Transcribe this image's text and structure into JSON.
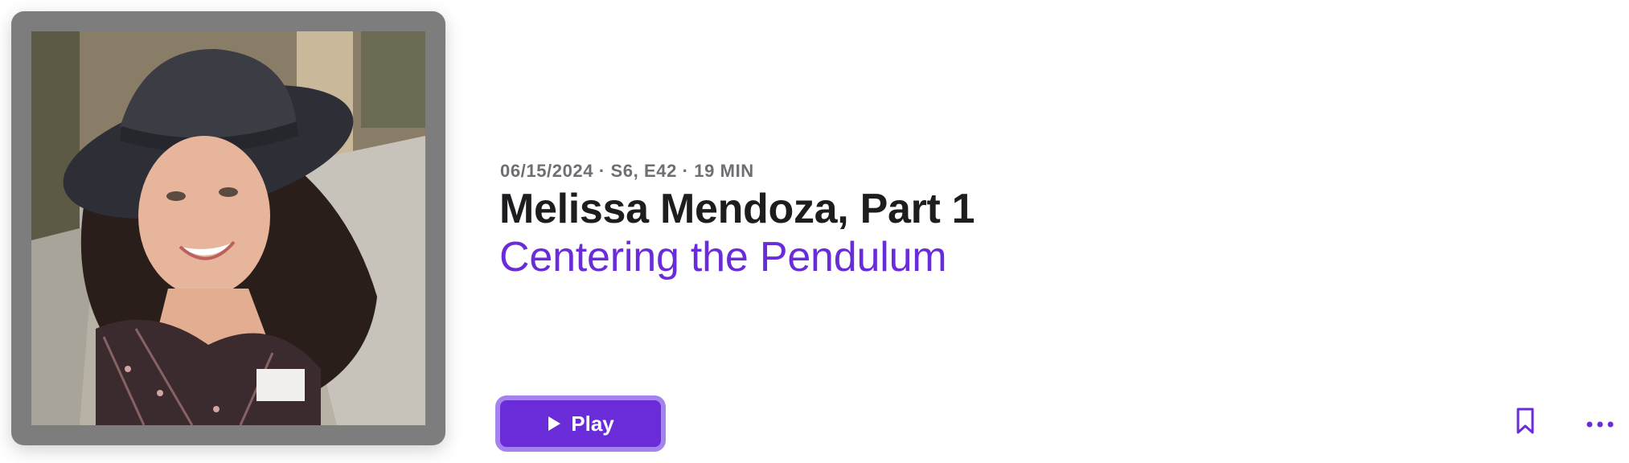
{
  "episode": {
    "meta": "06/15/2024 · S6, E42 · 19 MIN",
    "title": "Melissa Mendoza, Part 1",
    "show_name": "Centering the Pendulum"
  },
  "actions": {
    "play_label": "Play",
    "play_icon": "play-icon",
    "bookmark_icon": "bookmark-icon",
    "more_icon": "ellipsis-icon"
  },
  "colors": {
    "accent": "#6a2bd9",
    "accent_border": "#a483ec",
    "artwork_frame": "#7d7d7d",
    "meta_text": "#6e6e73",
    "title_text": "#1d1d1f"
  }
}
